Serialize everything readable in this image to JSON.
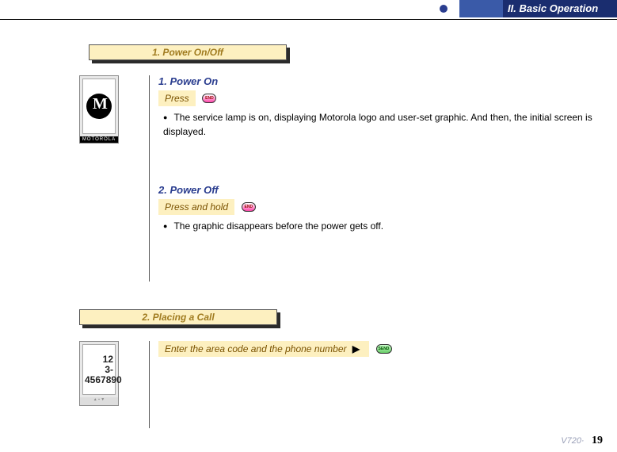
{
  "header": {
    "chapter": "II. Basic Operation"
  },
  "sections": [
    {
      "title": "1. Power On/Off"
    },
    {
      "title": "2. Placing a Call"
    }
  ],
  "power_on": {
    "title": "1. Power On",
    "instruction": "Press",
    "bullet": "The service lamp is on, displaying Motorola logo and user-set graphic. And then, the initial screen is displayed."
  },
  "power_off": {
    "title": "2. Power Off",
    "instruction": "Press and hold",
    "bullet": "The graphic disappears before the power gets off."
  },
  "call": {
    "instruction": "Enter the area code and the phone number",
    "display_line1": "12",
    "display_line2": "3-4567890"
  },
  "footer": {
    "model": "V720·",
    "page": "19"
  },
  "brand": {
    "label": "MOTOROLA"
  }
}
